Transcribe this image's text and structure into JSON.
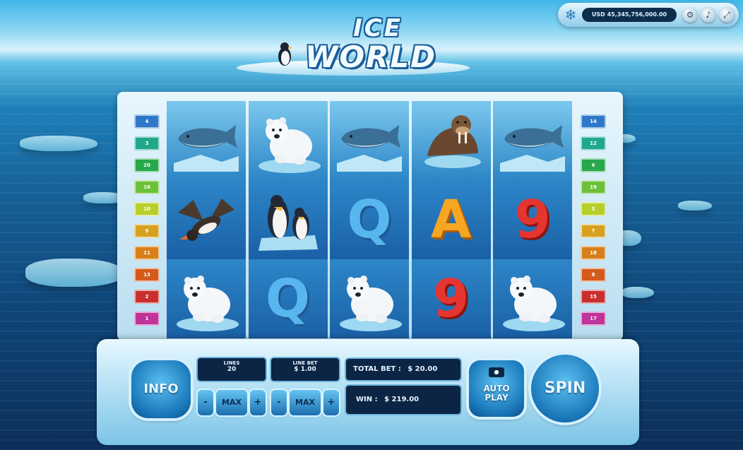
{
  "balance": "USD 45,345,756,000.00",
  "top_buttons": [
    "settings-icon",
    "sound-icon",
    "fullscreen-icon"
  ],
  "logo": {
    "line1": "ICE",
    "line2": "WORLD"
  },
  "left_lines": [
    "4",
    "3",
    "20",
    "16",
    "10",
    "9",
    "11",
    "13",
    "2",
    "1"
  ],
  "right_lines": [
    "14",
    "12",
    "6",
    "19",
    "5",
    "7",
    "18",
    "8",
    "15",
    "17"
  ],
  "left_tab_colors": [
    "#2f78c9",
    "#1fa88c",
    "#27a84a",
    "#6cc13a",
    "#b7cf2a",
    "#d7a11e",
    "#d87f1a",
    "#d45a1c",
    "#c92f2f",
    "#c0339a"
  ],
  "right_tab_colors": [
    "#2f78c9",
    "#1fa88c",
    "#27a84a",
    "#6cc13a",
    "#b7cf2a",
    "#d7a11e",
    "#d87f1a",
    "#d45a1c",
    "#c92f2f",
    "#c0339a"
  ],
  "reels": [
    [
      "whale",
      "puffin",
      "polar-bear"
    ],
    [
      "polar-bear",
      "penguins",
      "Q"
    ],
    [
      "whale",
      "Q",
      "polar-bear"
    ],
    [
      "walrus",
      "A",
      "9"
    ],
    [
      "whale",
      "9",
      "polar-bear"
    ]
  ],
  "controls": {
    "info": "INFO",
    "lines_label": "LINES",
    "lines_value": "20",
    "line_bet_label": "LINE BET",
    "line_bet_value": "$ 1.00",
    "minus": "-",
    "max": "MAX",
    "plus": "+",
    "total_bet_label": "TOTAL BET :",
    "total_bet_value": "$ 20.00",
    "win_label": "WIN :",
    "win_value": "$ 219.00",
    "auto_play": "AUTO PLAY",
    "spin": "SPIN"
  }
}
